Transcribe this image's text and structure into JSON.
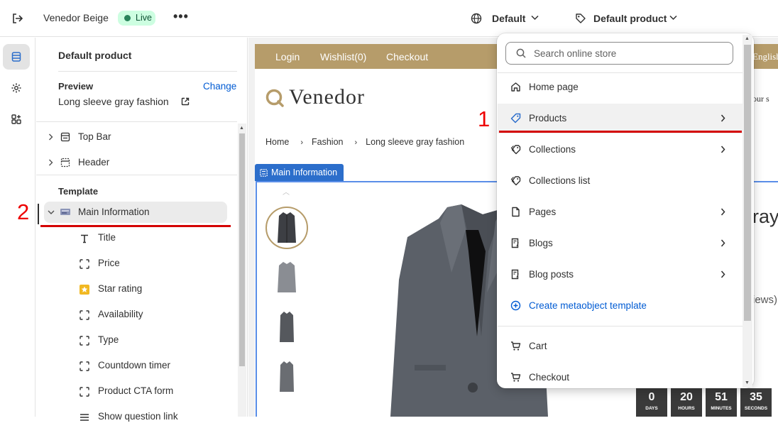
{
  "topbar": {
    "store_name": "Venedor Beige",
    "status_badge": "Live",
    "more": "•••",
    "language_select": "Default",
    "template_select": "Default product"
  },
  "sidebar": {
    "title": "Default product",
    "preview_label": "Preview",
    "change_link": "Change",
    "preview_value": "Long sleeve gray fashion",
    "sections": [
      {
        "label": "Top Bar",
        "icon": "top-bar-icon"
      },
      {
        "label": "Header",
        "icon": "header-icon"
      }
    ],
    "template_label": "Template",
    "main_section": {
      "label": "Main Information",
      "icon": "section-thumbnail-icon"
    },
    "blocks": [
      {
        "label": "Title",
        "icon": "text-icon"
      },
      {
        "label": "Price",
        "icon": "block-icon"
      },
      {
        "label": "Star rating",
        "icon": "app-star-icon"
      },
      {
        "label": "Availability",
        "icon": "block-icon"
      },
      {
        "label": "Type",
        "icon": "block-icon"
      },
      {
        "label": "Countdown timer",
        "icon": "block-icon"
      },
      {
        "label": "Product CTA form",
        "icon": "block-icon"
      },
      {
        "label": "Show question link",
        "icon": "list-icon"
      }
    ]
  },
  "annotations": {
    "one": "1",
    "two": "2"
  },
  "preview": {
    "nav": [
      "Login",
      "Wishlist(0)",
      "Checkout"
    ],
    "language": "English",
    "logo": "Venedor",
    "partial_text": "our s",
    "breadcrumb": [
      "Home",
      "Fashion",
      "Long sleeve gray fashion"
    ],
    "section_tag": "Main Information",
    "partial_title": "ray",
    "partial_reviews": "iews)",
    "countdown": [
      {
        "value": "0",
        "unit": "DAYS"
      },
      {
        "value": "20",
        "unit": "HOURS"
      },
      {
        "value": "51",
        "unit": "MINUTES"
      },
      {
        "value": "35",
        "unit": "SECONDS"
      }
    ]
  },
  "dropdown": {
    "search_placeholder": "Search online store",
    "items": [
      {
        "label": "Home page",
        "icon": "home-icon",
        "submenu": false
      },
      {
        "label": "Products",
        "icon": "tag-icon",
        "submenu": true,
        "highlighted": true
      },
      {
        "label": "Collections",
        "icon": "collections-icon",
        "submenu": true
      },
      {
        "label": "Collections list",
        "icon": "collections-icon",
        "submenu": false
      },
      {
        "label": "Pages",
        "icon": "page-icon",
        "submenu": true
      },
      {
        "label": "Blogs",
        "icon": "blog-icon",
        "submenu": true
      },
      {
        "label": "Blog posts",
        "icon": "blog-icon",
        "submenu": true
      },
      {
        "label": "Create metaobject template",
        "icon": "plus-circle-icon",
        "submenu": false
      }
    ],
    "items2": [
      {
        "label": "Cart",
        "icon": "cart-icon"
      },
      {
        "label": "Checkout",
        "icon": "cart-icon"
      }
    ]
  },
  "colors": {
    "accent": "#005bd3",
    "store_brand": "#b69c6a",
    "annotation": "#d40000"
  }
}
